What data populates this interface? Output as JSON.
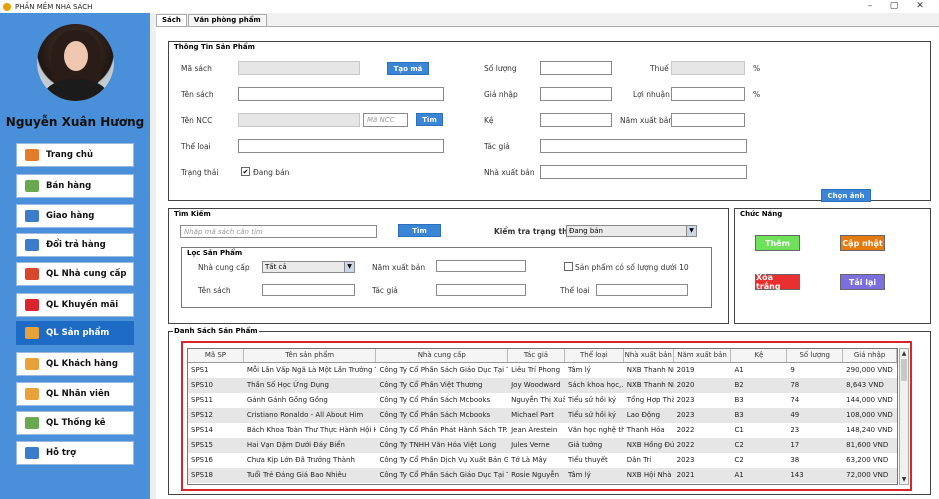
{
  "window": {
    "title": "PHẦN MỀM NHÀ SÁCH",
    "minimize": "–",
    "maximize": "▢",
    "close": "✕"
  },
  "sidebar": {
    "username": "Nguyễn Xuân Hương",
    "items": [
      {
        "label": "Trang chủ",
        "icon": "home-icon",
        "color": "#e37c2b"
      },
      {
        "label": "Bán hàng",
        "icon": "cart-icon",
        "color": "#6aa84f"
      },
      {
        "label": "Giao hàng",
        "icon": "truck-icon",
        "color": "#3d7cc9"
      },
      {
        "label": "Đổi trả hàng",
        "icon": "refresh-icon",
        "color": "#3d7cc9"
      },
      {
        "label": "QL Nhà cung cấp",
        "icon": "factory-icon",
        "color": "#d9472b"
      },
      {
        "label": "QL Khuyến mãi",
        "icon": "sale-icon",
        "color": "#d9252b"
      },
      {
        "label": "QL Sản phẩm",
        "icon": "product-icon",
        "color": "#e8a23b"
      },
      {
        "label": "QL Khách hàng",
        "icon": "customer-icon",
        "color": "#e8a23b"
      },
      {
        "label": "QL Nhân viên",
        "icon": "employee-icon",
        "color": "#e8a23b"
      },
      {
        "label": "QL Thống kê",
        "icon": "chart-icon",
        "color": "#6aa84f"
      },
      {
        "label": "Hỗ trợ",
        "icon": "help-icon",
        "color": "#3d7cc9"
      }
    ]
  },
  "tabs": [
    "Sách",
    "Văn phòng phẩm"
  ],
  "info": {
    "title": "Thông Tin Sản Phẩm",
    "ma_sach": "Mã sách",
    "tao_ma": "Tạo mã",
    "so_luong": "Số lượng",
    "thue": "Thuế",
    "percent": "%",
    "ten_sach": "Tên sách",
    "gia_nhap": "Giá nhập",
    "loi_nhuan": "Lợi nhuận",
    "ten_ncc": "Tên NCC",
    "ma_ncc_placeholder": "Mã NCC",
    "tim": "Tìm",
    "ke": "Kệ",
    "nam_xuat_ban": "Năm xuất bản",
    "the_loai": "Thể loại",
    "tac_gia": "Tác giả",
    "trang_thai": "Trạng thái",
    "dang_ban": "Đang bán",
    "nha_xuat_ban": "Nhà xuất bản",
    "chon_anh": "Chọn ảnh"
  },
  "search": {
    "title": "Tìm Kiếm",
    "placeholder": "Nhập mã sách cần tìm",
    "tim": "Tìm",
    "kiem_tra_trang_thai": "Kiểm tra trạng thái",
    "trang_thai_value": "Đang bán",
    "loc_title": "Lọc Sản Phẩm",
    "nha_cung_cap": "Nhà cung cấp",
    "nha_cung_cap_value": "Tất cả",
    "nam_xuat_ban": "Năm xuất bản",
    "sp_duoi_10": "Sản phẩm có số lượng dưới 10",
    "ten_sach": "Tên sách",
    "tac_gia": "Tác giả",
    "the_loai": "Thể loại"
  },
  "functions": {
    "title": "Chức Năng",
    "them": "Thêm",
    "cap_nhat": "Cập nhật",
    "xoa_trang": "Xóa trắng",
    "tai_lai": "Tải lại",
    "colors": {
      "them": "#6ee05a",
      "cap_nhat": "#e57a10",
      "xoa_trang": "#e83030",
      "tai_lai": "#7b6fe0"
    }
  },
  "list": {
    "title": "Danh Sách Sản Phẩm",
    "columns": [
      "Mã SP",
      "Tên sản phẩm",
      "Nhà cung cấp",
      "Tác giả",
      "Thể loại",
      "Nhà xuất bản",
      "Năm xuất bản",
      "Kệ",
      "Số lượng",
      "Giá nhập"
    ],
    "rows": [
      [
        "SPS1",
        "Mỗi Lần Vấp Ngã Là Một Lần Trưởng Thà...",
        "Công Ty Cổ Phần Sách Giáo Dục Tại Th...",
        "Liêu Trí Phong",
        "Tâm lý",
        "NXB Thanh Niên",
        "2019",
        "A1",
        "9",
        "290,000 VND"
      ],
      [
        "SPS10",
        "Thần Số Học Ứng Dụng",
        "Công Ty Cổ Phần Việt Thương",
        "Joy Woodward",
        "Sách khoa học,...",
        "NXB Thanh Niên",
        "2020",
        "B2",
        "78",
        "8,643 VND"
      ],
      [
        "SPS11",
        "Gánh Gánh Gồng Gồng",
        "Công Ty Cổ Phần Sách Mcbooks",
        "Nguyễn Thị Xuâ...",
        "Tiểu sử hồi ký",
        "Tổng Hợp Thàn...",
        "2023",
        "B3",
        "74",
        "144,000 VND"
      ],
      [
        "SPS12",
        "Cristiano Ronaldo - All About Him",
        "Công Ty Cổ Phần Sách Mcbooks",
        "Michael Part",
        "Tiểu sử hồi ký",
        "Lao Động",
        "2023",
        "B3",
        "49",
        "108,000 VND"
      ],
      [
        "SPS14",
        "Bách Khoa Toàn Thư Thực Hành Hội Họ...",
        "Công Ty Cổ Phần Phát Hành Sách TP...",
        "Jean Arestein",
        "Văn học nghệ th...",
        "Thanh Hóa",
        "2022",
        "C1",
        "23",
        "148,240 VND"
      ],
      [
        "SPS15",
        "Hai Vạn Dặm Dưới Đáy Biển",
        "Công Ty TNHH Văn Hóa Việt Long",
        "Jules Verne",
        "Giả tưởng",
        "NXB Hồng Đức",
        "2022",
        "C2",
        "17",
        "81,600 VND"
      ],
      [
        "SPS16",
        "Chưa Kịp Lớn Đã Trưởng Thành",
        "Công Ty Cổ Phần Dịch Vụ Xuất Bản Giá...",
        "Tớ Là Mây",
        "Tiểu thuyết",
        "Dân Trí",
        "2023",
        "C2",
        "38",
        "63,200 VND"
      ],
      [
        "SPS18",
        "Tuổi Trẻ Đáng Giá Bao Nhiêu",
        "Công Ty Cổ Phần Sách Giáo Dục Tại Th...",
        "Rosie Nguyễn",
        "Tâm lý",
        "NXB Hội Nhà V...",
        "2021",
        "A1",
        "143",
        "72,000 VND"
      ]
    ]
  }
}
